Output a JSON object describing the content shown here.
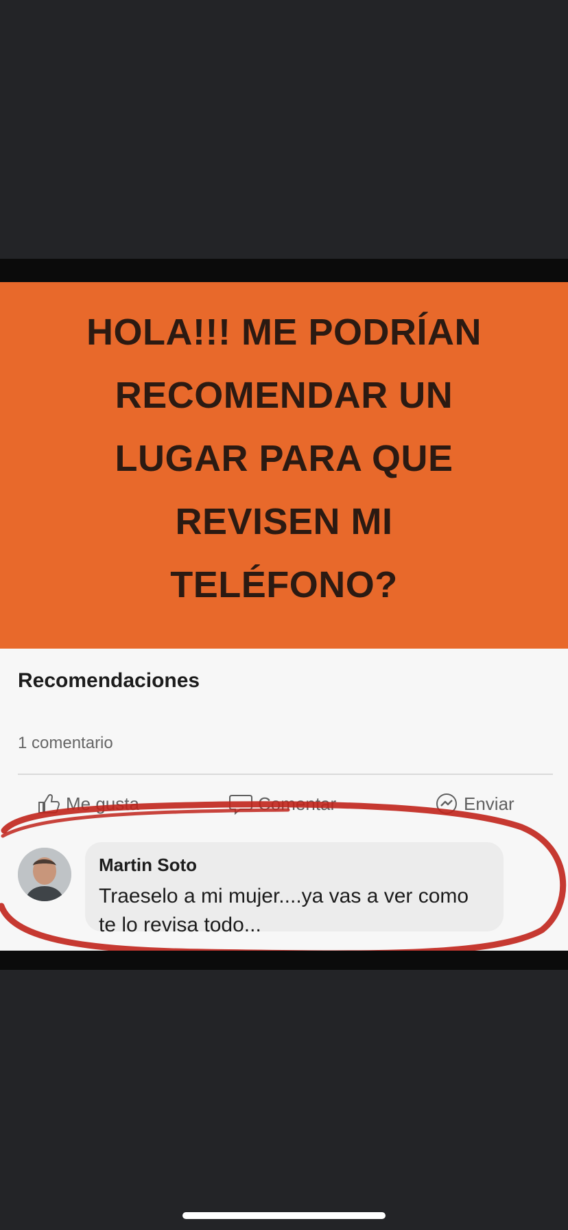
{
  "post": {
    "headline": "HOLA!!! ME PODRÍAN\nRECOMENDAR UN\nLUGAR PARA QUE\nREVISEN MI\nTELÉFONO?"
  },
  "card": {
    "section_title": "Recomendaciones",
    "comment_count": "1 comentario",
    "actions": {
      "like_label": "Me gusta",
      "comment_label": "Comentar",
      "send_label": "Enviar"
    }
  },
  "comment": {
    "author": "Martin Soto",
    "text": "Traeselo a mi mujer....ya vas a ver como\nte lo revisa todo..."
  },
  "colors": {
    "post_background": "#e8692b",
    "headline_text": "#2b1a12",
    "highlight_circle": "#c0231b",
    "page_background": "#232427"
  }
}
